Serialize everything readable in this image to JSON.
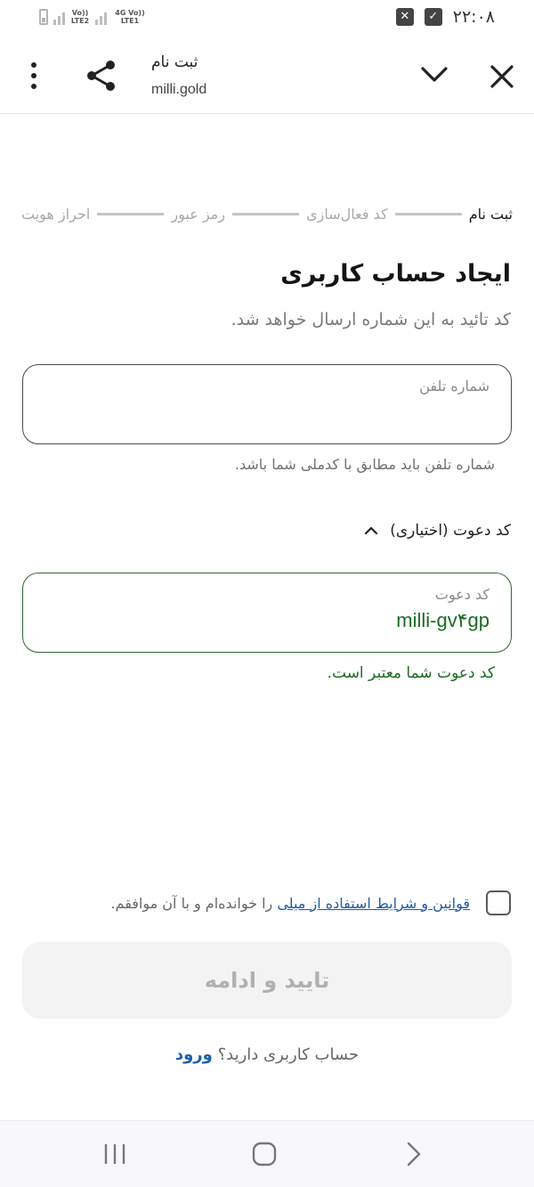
{
  "status_bar": {
    "time": "۲۲:۰۸",
    "net1": "Vo)) LTE2",
    "net2": "4G Vo)) LTE1"
  },
  "browser": {
    "title": "ثبت نام",
    "url": "milli.gold"
  },
  "stepper": {
    "steps": [
      "ثبت نام",
      "کد فعال‌سازی",
      "رمز عبور",
      "احراز هویت"
    ]
  },
  "form": {
    "title": "ایجاد حساب کاربری",
    "subtitle": "کد تائید به این شماره ارسال خواهد شد.",
    "phone_label": "شماره تلفن",
    "phone_value": "",
    "phone_helper": "شماره تلفن باید مطابق با کدملی شما باشد.",
    "referral_toggle": "کد دعوت (اختیاری)",
    "referral_label": "کد دعوت",
    "referral_value": "milli-gv۴gp",
    "referral_helper": "کد دعوت شما معتبر است.",
    "terms_link": "قوانین و شرایط استفاده از میلی",
    "terms_rest": " را خوانده‌ام و با آن موافقم.",
    "submit": "تایید و ادامه",
    "login_question": "حساب کاربری دارید؟ ",
    "login_link": "ورود"
  },
  "colors": {
    "accent_green": "#1d6b24",
    "link_blue": "#1f5c9e"
  }
}
